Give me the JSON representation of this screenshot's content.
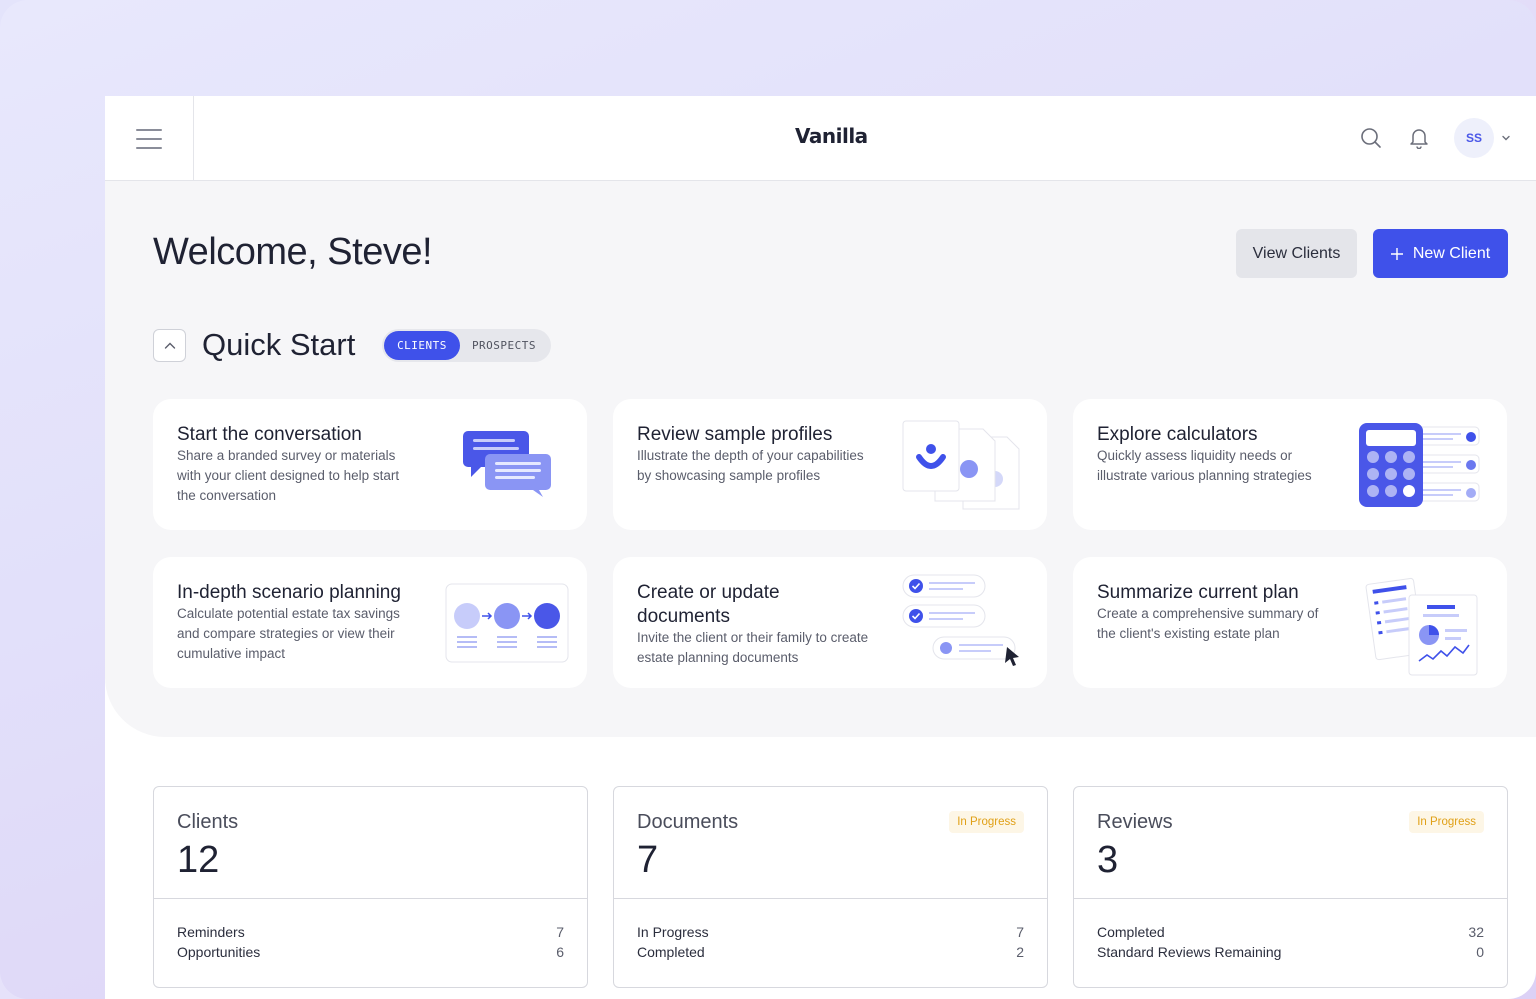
{
  "header": {
    "logo": "Vanilla",
    "avatar_initials": "SS",
    "icons": [
      "menu-icon",
      "search-icon",
      "bell-icon",
      "chevron-down-icon"
    ]
  },
  "main": {
    "welcome": "Welcome, Steve!",
    "view_clients_label": "View Clients",
    "new_client_label": "New Client",
    "quick_start": {
      "title": "Quick Start",
      "tabs": [
        "CLIENTS",
        "PROSPECTS"
      ],
      "active_tab": "CLIENTS"
    },
    "cards": [
      {
        "title": "Start the conversation",
        "desc_lines": [
          "Share a branded survey or materials",
          "with your client designed to help start",
          "the conversation"
        ]
      },
      {
        "title": "Review sample profiles",
        "desc_lines": [
          "Illustrate the depth of your capabilities",
          "by showcasing sample profiles"
        ]
      },
      {
        "title": "Explore calculators",
        "desc_lines": [
          "Quickly assess liquidity needs or",
          "illustrate various planning strategies"
        ]
      },
      {
        "title": "In-depth scenario planning",
        "desc_lines": [
          "Calculate potential estate tax savings",
          "and compare strategies or view their",
          "cumulative impact"
        ]
      },
      {
        "title_lines": [
          "Create or update",
          "documents"
        ],
        "desc_lines": [
          "Invite the client or their family to create",
          "estate planning documents"
        ]
      },
      {
        "title": "Summarize current plan",
        "desc_lines": [
          "Create a comprehensive summary of",
          "the client's existing estate plan"
        ]
      }
    ]
  },
  "stats": [
    {
      "label": "Clients",
      "value": "12",
      "badge": "",
      "rows": [
        {
          "label": "Reminders",
          "value": "7"
        },
        {
          "label": "Opportunities",
          "value": "6"
        }
      ]
    },
    {
      "label": "Documents",
      "value": "7",
      "badge": "In Progress",
      "rows": [
        {
          "label": "In Progress",
          "value": "7"
        },
        {
          "label": "Completed",
          "value": "2"
        }
      ]
    },
    {
      "label": "Reviews",
      "value": "3",
      "badge": "In Progress",
      "rows": [
        {
          "label": "Completed",
          "value": "32"
        },
        {
          "label": "Standard Reviews Remaining",
          "value": "0"
        }
      ]
    }
  ],
  "colors": {
    "accent": "#3f51ea",
    "badge_text": "#e0a017",
    "badge_bg": "#fdf6e6",
    "panel_bg": "#f6f6f8"
  }
}
